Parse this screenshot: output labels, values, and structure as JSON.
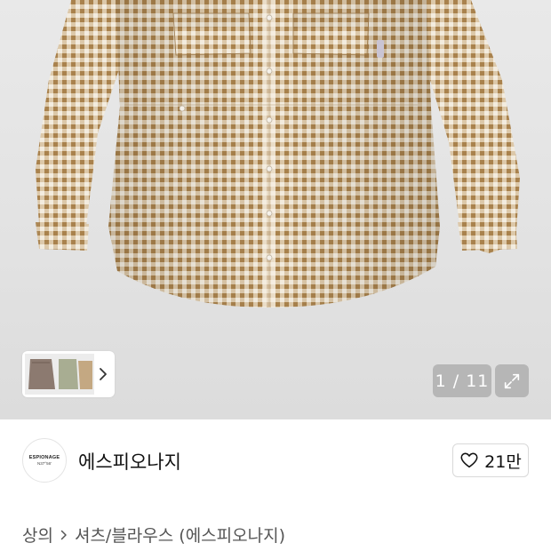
{
  "gallery": {
    "counter": "1 / 11"
  },
  "icons": {
    "variant_arrow": "chevron-right-icon",
    "expand": "expand-icon",
    "like": "heart-outline-icon",
    "breadcrumb_separator": "chevron-right-icon"
  },
  "brand": {
    "logo_text": "ESPIONAGE",
    "logo_subtext": "N37°56'",
    "name": "에스피오나지"
  },
  "like": {
    "count": "21만"
  },
  "breadcrumb": {
    "category": "상의",
    "subcategory": "셔츠/블라우스 (에스피오나지)"
  },
  "colors": {
    "check_brown": "#b8935a",
    "check_cream": "#f2eadb",
    "counter_bg": "#969696"
  }
}
